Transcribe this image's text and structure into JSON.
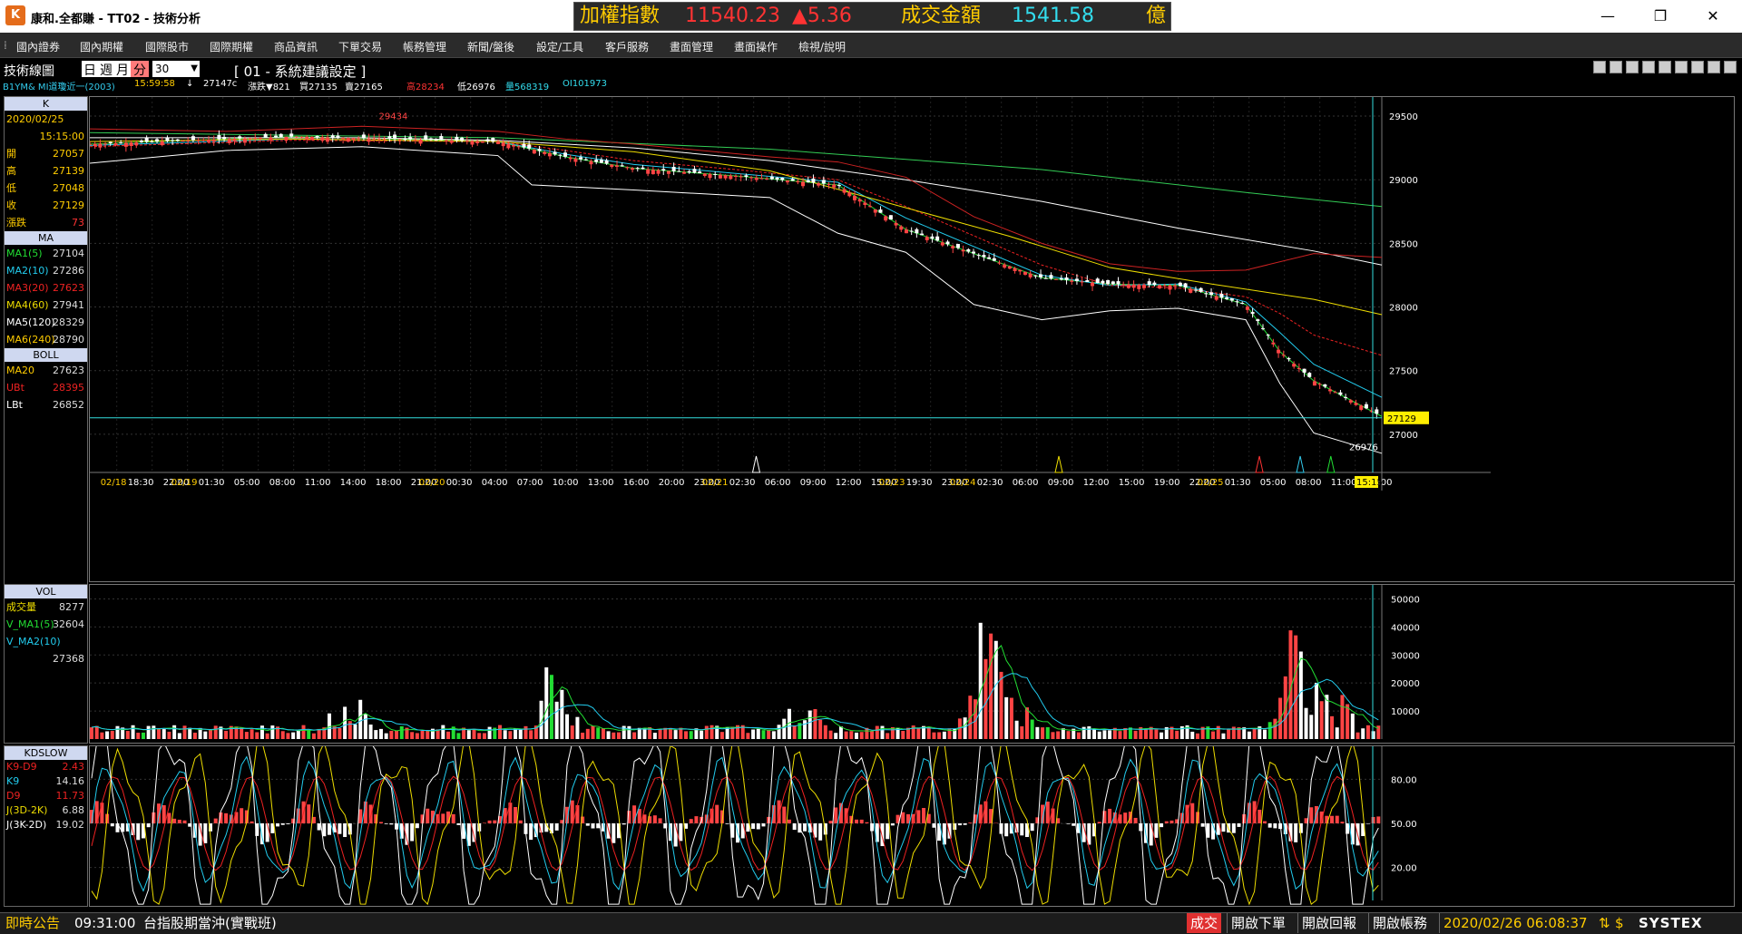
{
  "window": {
    "title": "康和.全都賺 - TT02 - 技術分析",
    "logo": "K"
  },
  "ticker": {
    "label": "加權指數",
    "value": "11540.23",
    "change": "▲5.36",
    "amount_label": "成交金額",
    "amount": "1541.58",
    "unit": "億"
  },
  "controls": {
    "minimize": "—",
    "restore": "❐",
    "close": "✕"
  },
  "menu": [
    "國內證券",
    "國內期權",
    "國際股市",
    "國際期權",
    "商品資訊",
    "下單交易",
    "帳務管理",
    "新聞/盤後",
    "設定/工具",
    "客戶服務",
    "畫面管理",
    "畫面操作",
    "檢視/說明"
  ],
  "toolbar": {
    "title": "技術線圖",
    "periods": [
      "日",
      "週",
      "月",
      "分"
    ],
    "active_period": "分",
    "minutes": "30",
    "setting": "[ 01 - 系統建議設定 ]"
  },
  "infoline": {
    "symbol": "B1YM&  MI道瓊近一(2003)",
    "time": "15:59:58",
    "arrow": "↓",
    "last": "27147c",
    "chg": "漲跌▼821",
    "buy": "買27135",
    "sell": "賣27165",
    "high": "高28234",
    "low": "低26976",
    "vol": "量568319",
    "oi": "OI101973"
  },
  "panel_k": {
    "head": "K",
    "date": "2020/02/25",
    "time": "15:15:00",
    "rows": [
      {
        "label": "開",
        "value": "27057"
      },
      {
        "label": "高",
        "value": "27139"
      },
      {
        "label": "低",
        "value": "27048"
      },
      {
        "label": "收",
        "value": "27129"
      },
      {
        "label": "漲跌",
        "value": "73"
      }
    ]
  },
  "panel_ma": {
    "head": "MA",
    "rows": [
      {
        "label": "MA1(5)",
        "value": "27104",
        "color": "#22dd33"
      },
      {
        "label": "MA2(10)",
        "value": "27286",
        "color": "#22ccee"
      },
      {
        "label": "MA3(20)",
        "value": "27623",
        "color": "#ee2222"
      },
      {
        "label": "MA4(60)",
        "value": "27941",
        "color": "#eedd00"
      },
      {
        "label": "MA5(120)",
        "value": "28329",
        "color": "#ffffff"
      },
      {
        "label": "MA6(240)",
        "value": "28790",
        "color": "#ffcc00"
      }
    ]
  },
  "panel_boll": {
    "head": "BOLL",
    "rows": [
      {
        "label": "MA20",
        "value": "27623",
        "color": "#ffcc00"
      },
      {
        "label": "UBt",
        "value": "28395",
        "color": "#ee2222"
      },
      {
        "label": "LBt",
        "value": "26852",
        "color": "#ffffff"
      }
    ]
  },
  "panel_vol": {
    "head": "VOL",
    "rows": [
      {
        "label": "成交量",
        "value": "8277",
        "color": "#eedd00"
      },
      {
        "label": "V_MA1(5)",
        "value": "32604",
        "color": "#22dd33"
      },
      {
        "label": "V_MA2(10)",
        "value": "",
        "color": "#22ccee"
      },
      {
        "label": "",
        "value": "27368",
        "color": "#22ccee"
      }
    ]
  },
  "panel_kd": {
    "head": "KDSLOW",
    "rows": [
      {
        "label": "K9-D9",
        "value": "2.43",
        "color": "#ee2222"
      },
      {
        "label": "K9",
        "value": "14.16",
        "color": "#22ccee"
      },
      {
        "label": "D9",
        "value": "11.73",
        "color": "#ee2222"
      },
      {
        "label": "J(3D-2K)",
        "value": "6.88",
        "color": "#eedd00"
      },
      {
        "label": "J(3K-2D)",
        "value": "19.02",
        "color": "#ffffff"
      }
    ]
  },
  "chart_data": [
    {
      "type": "candlestick",
      "y_ticks": [
        "29500",
        "29000",
        "28500",
        "28000",
        "27500",
        "27000"
      ],
      "ylim": [
        26700,
        29650
      ],
      "last_price": "27129",
      "high_label": "29434",
      "low_label": "26976",
      "x_labels": [
        {
          "d": "02/18",
          "t": "18:30"
        },
        {
          "d": "",
          "t": "22:00"
        },
        {
          "d": "02/19",
          "t": "01:30"
        },
        {
          "d": "",
          "t": "05:00"
        },
        {
          "d": "",
          "t": "08:00"
        },
        {
          "d": "",
          "t": "11:00"
        },
        {
          "d": "",
          "t": "14:00"
        },
        {
          "d": "",
          "t": "18:00"
        },
        {
          "d": "",
          "t": "21:00"
        },
        {
          "d": "02/20",
          "t": "00:30"
        },
        {
          "d": "",
          "t": "04:00"
        },
        {
          "d": "",
          "t": "07:00"
        },
        {
          "d": "",
          "t": "10:00"
        },
        {
          "d": "",
          "t": "13:00"
        },
        {
          "d": "",
          "t": "16:00"
        },
        {
          "d": "",
          "t": "20:00"
        },
        {
          "d": "",
          "t": "23:00"
        },
        {
          "d": "02/21",
          "t": "02:30"
        },
        {
          "d": "",
          "t": "06:00"
        },
        {
          "d": "",
          "t": "09:00"
        },
        {
          "d": "",
          "t": "12:00"
        },
        {
          "d": "",
          "t": "15:00"
        },
        {
          "d": "02/23",
          "t": "19:30"
        },
        {
          "d": "",
          "t": "23:00"
        },
        {
          "d": "02/24",
          "t": "02:30"
        },
        {
          "d": "",
          "t": "06:00"
        },
        {
          "d": "",
          "t": "09:00"
        },
        {
          "d": "",
          "t": "12:00"
        },
        {
          "d": "",
          "t": "15:00"
        },
        {
          "d": "",
          "t": "19:00"
        },
        {
          "d": "",
          "t": "22:00"
        },
        {
          "d": "02/25",
          "t": "01:30"
        },
        {
          "d": "",
          "t": "05:00"
        },
        {
          "d": "",
          "t": "08:00"
        },
        {
          "d": "",
          "t": "11:00"
        },
        {
          "d": "",
          "t": "14:00"
        }
      ],
      "last_time": "15:15",
      "series": [
        {
          "name": "MA1(5)",
          "color": "#22dd33",
          "x": [
            0,
            6,
            12,
            14,
            16,
            19,
            22,
            24,
            28,
            30,
            32,
            34,
            35,
            36,
            38
          ],
          "y": [
            29280,
            29340,
            29300,
            29180,
            29090,
            29030,
            28960,
            28610,
            28230,
            28180,
            28170,
            28020,
            27650,
            27420,
            27140
          ]
        },
        {
          "name": "MA2(10)",
          "color": "#22ccee",
          "x": [
            0,
            6,
            12,
            14,
            16,
            19,
            22,
            24,
            28,
            30,
            32,
            34,
            35,
            36,
            38
          ],
          "y": [
            29270,
            29320,
            29300,
            29200,
            29120,
            29050,
            28980,
            28700,
            28250,
            28170,
            28180,
            28040,
            27800,
            27550,
            27290
          ]
        },
        {
          "name": "MA3(20)",
          "color": "#ee2222",
          "x": [
            0,
            6,
            12,
            14,
            16,
            19,
            22,
            24,
            28,
            30,
            32,
            34,
            35,
            36,
            38
          ],
          "y": [
            29260,
            29310,
            29300,
            29230,
            29150,
            29080,
            29000,
            28790,
            28330,
            28170,
            28150,
            28080,
            27950,
            27780,
            27620
          ]
        },
        {
          "name": "MA4(60)",
          "color": "#eedd00",
          "x": [
            0,
            6,
            12,
            16,
            20,
            24,
            27,
            30,
            33,
            36,
            38
          ],
          "y": [
            29300,
            29320,
            29300,
            29220,
            29070,
            28780,
            28560,
            28310,
            28180,
            28060,
            27940
          ]
        },
        {
          "name": "MA5(120)",
          "color": "#ffffff",
          "x": [
            0,
            8,
            12,
            16,
            20,
            24,
            28,
            32,
            36,
            38
          ],
          "y": [
            29330,
            29330,
            29310,
            29250,
            29150,
            29000,
            28830,
            28620,
            28440,
            28330
          ]
        },
        {
          "name": "MA6(240)",
          "color": "#33cc55",
          "x": [
            0,
            12,
            20,
            28,
            34,
            38
          ],
          "y": [
            29370,
            29330,
            29240,
            29080,
            28900,
            28790
          ]
        },
        {
          "name": "UBt",
          "color": "#cc2222",
          "x": [
            0,
            4,
            8,
            12,
            14,
            16,
            18,
            20,
            22,
            24,
            26,
            28,
            30,
            32,
            34,
            36,
            38
          ],
          "y": [
            29400,
            29380,
            29420,
            29380,
            29320,
            29280,
            29230,
            29180,
            29140,
            29020,
            28710,
            28500,
            28340,
            28280,
            28290,
            28420,
            28390
          ]
        },
        {
          "name": "LBt",
          "color": "#ffffff",
          "x": [
            0,
            4,
            8,
            12,
            13,
            16,
            18,
            20,
            22,
            24,
            26,
            28,
            30,
            32,
            34,
            35,
            36,
            38
          ],
          "y": [
            29130,
            29230,
            29260,
            29190,
            28960,
            28920,
            28890,
            28860,
            28580,
            28430,
            28020,
            27900,
            27970,
            27990,
            27900,
            27400,
            27010,
            26850
          ]
        }
      ]
    },
    {
      "type": "bar",
      "y_ticks": [
        "50000",
        "40000",
        "30000",
        "20000",
        "10000"
      ],
      "ylim": [
        0,
        55000
      ]
    },
    {
      "type": "line",
      "y_ticks": [
        "80.00",
        "50.00",
        "20.00"
      ],
      "ylim": [
        0,
        100
      ]
    }
  ],
  "status": {
    "notice": "即時公告",
    "time": "09:31:00",
    "message": "台指股期當沖(實戰班)",
    "deal": "成交",
    "btn1": "開啟下單",
    "btn2": "開啟回報",
    "btn3": "開啟帳務",
    "datetime": "2020/02/26 06:08:37",
    "brand": "SYSTEX"
  }
}
